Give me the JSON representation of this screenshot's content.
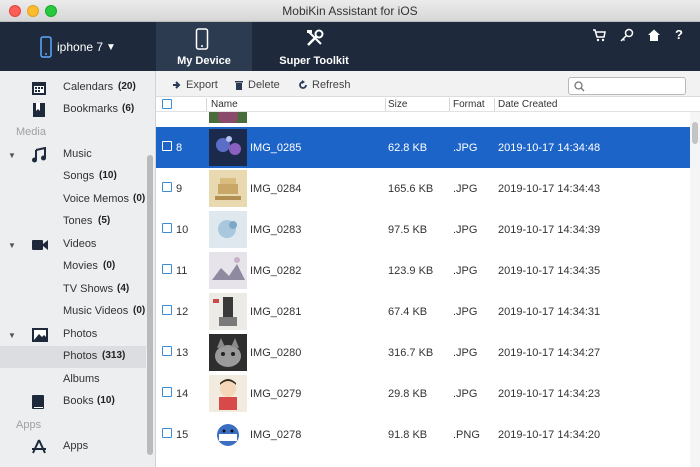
{
  "window": {
    "title": "MobiKin Assistant for iOS"
  },
  "device": {
    "name": "iphone 7"
  },
  "tabs": [
    {
      "label": "My Device",
      "active": true
    },
    {
      "label": "Super Toolkit",
      "active": false
    }
  ],
  "top_icons": [
    "cart-icon",
    "key-icon",
    "home-icon",
    "help-icon"
  ],
  "sidebar": {
    "items": [
      {
        "label": "Calendars",
        "count": "(20)",
        "icon": "calendar-icon"
      },
      {
        "label": "Bookmarks",
        "count": "(6)",
        "icon": "bookmark-icon"
      }
    ],
    "section_media": "Media",
    "media": [
      {
        "label": "Music",
        "icon": "music-icon"
      },
      {
        "label": "Songs",
        "count": "(10)"
      },
      {
        "label": "Voice Memos",
        "count": "(0)"
      },
      {
        "label": "Tones",
        "count": "(5)"
      },
      {
        "label": "Videos",
        "icon": "video-icon"
      },
      {
        "label": "Movies",
        "count": "(0)"
      },
      {
        "label": "TV Shows",
        "count": "(4)"
      },
      {
        "label": "Music Videos",
        "count": "(0)"
      },
      {
        "label": "Photos",
        "icon": "photo-icon"
      },
      {
        "label": "Photos",
        "count": "(313)",
        "selected": true
      },
      {
        "label": "Albums"
      },
      {
        "label": "Books",
        "count": "(10)",
        "icon": "book-icon"
      }
    ],
    "section_apps": "Apps",
    "apps": [
      {
        "label": "Apps",
        "icon": "apps-icon"
      }
    ]
  },
  "toolbar": {
    "export": "Export",
    "delete": "Delete",
    "refresh": "Refresh",
    "search_placeholder": ""
  },
  "columns": {
    "name": "Name",
    "size": "Size",
    "format": "Format",
    "date": "Date Created"
  },
  "rows": [
    {
      "index": "8",
      "name": "IMG_0285",
      "size": "62.8 KB",
      "format": ".JPG",
      "date": "2019-10-17 14:34:48",
      "selected": true
    },
    {
      "index": "9",
      "name": "IMG_0284",
      "size": "165.6 KB",
      "format": ".JPG",
      "date": "2019-10-17 14:34:43"
    },
    {
      "index": "10",
      "name": "IMG_0283",
      "size": "97.5 KB",
      "format": ".JPG",
      "date": "2019-10-17 14:34:39"
    },
    {
      "index": "11",
      "name": "IMG_0282",
      "size": "123.9 KB",
      "format": ".JPG",
      "date": "2019-10-17 14:34:35"
    },
    {
      "index": "12",
      "name": "IMG_0281",
      "size": "67.4 KB",
      "format": ".JPG",
      "date": "2019-10-17 14:34:31"
    },
    {
      "index": "13",
      "name": "IMG_0280",
      "size": "316.7 KB",
      "format": ".JPG",
      "date": "2019-10-17 14:34:27"
    },
    {
      "index": "14",
      "name": "IMG_0279",
      "size": "29.8 KB",
      "format": ".JPG",
      "date": "2019-10-17 14:34:23"
    },
    {
      "index": "15",
      "name": "IMG_0278",
      "size": "91.8 KB",
      "format": ".PNG",
      "date": "2019-10-17 14:34:20"
    }
  ],
  "colors": {
    "topbar": "#1e2a3c",
    "selection": "#1d64c9",
    "checkbox": "#3f8bd4"
  }
}
